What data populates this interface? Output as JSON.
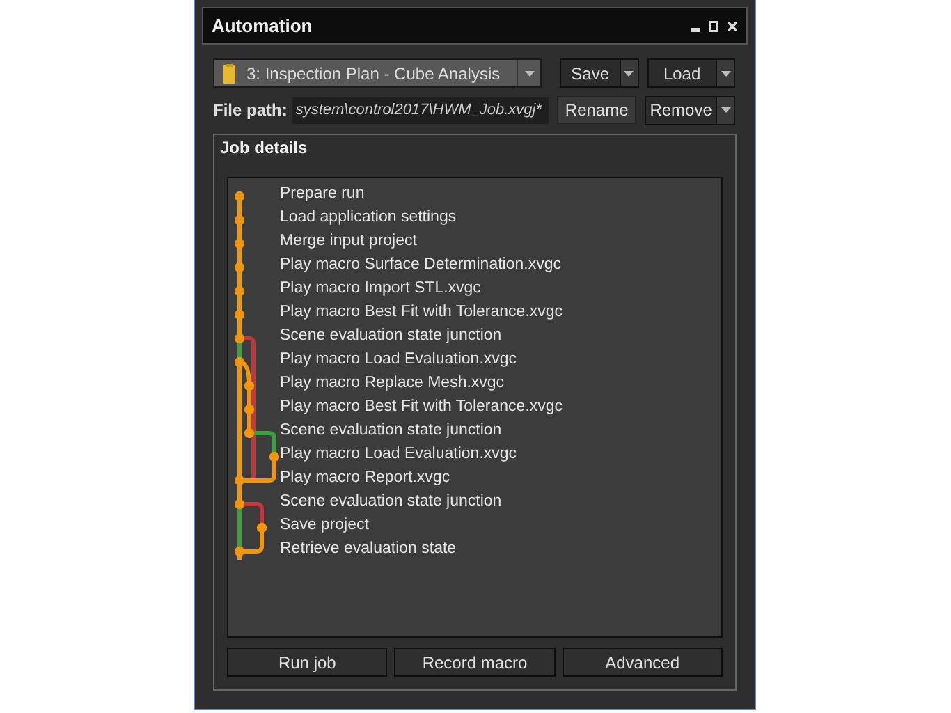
{
  "window": {
    "title": "Automation"
  },
  "job_selector": {
    "value": "3: Inspection Plan - Cube Analysis"
  },
  "top_buttons": [
    {
      "label": "Save",
      "kind": "split"
    },
    {
      "label": "Load",
      "kind": "split"
    }
  ],
  "file_path": {
    "label": "File path:",
    "value": "system\\control2017\\HWM_Job.xvgj*"
  },
  "path_buttons": [
    {
      "label": "Rename",
      "kind": "plain"
    },
    {
      "label": "Remove",
      "kind": "split"
    }
  ],
  "job_details": {
    "title": "Job details",
    "steps": [
      "Prepare run",
      "Load application settings",
      "Merge input project",
      "Play macro Surface Determination.xvgc",
      "Play macro Import STL.xvgc",
      "Play macro Best Fit with Tolerance.xvgc",
      "Scene evaluation state junction",
      "Play macro Load Evaluation.xvgc",
      "Play macro Replace Mesh.xvgc",
      "Play macro Best Fit with Tolerance.xvgc",
      "Scene evaluation state junction",
      "Play macro Load Evaluation.xvgc",
      "Play macro Report.xvgc",
      "Scene evaluation state junction",
      "Save project",
      "Retrieve evaluation state"
    ]
  },
  "bottom_buttons": [
    "Run job",
    "Record macro",
    "Advanced"
  ]
}
